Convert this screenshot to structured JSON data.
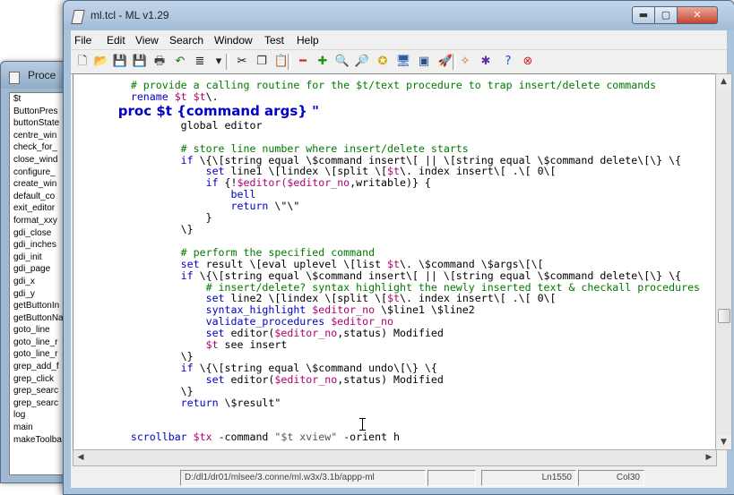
{
  "bg_window": {
    "title": "Proce",
    "items": [
      "$t",
      "ButtonPres",
      "buttonState",
      "centre_win",
      "check_for_",
      "close_wind",
      "configure_",
      "create_win",
      "default_co",
      "exit_editor",
      "format_xxy",
      "gdi_close",
      "gdi_inches",
      "gdi_init",
      "gdi_page",
      "gdi_x",
      "gdi_y",
      "getButtonIn",
      "getButtonNa",
      "goto_line",
      "goto_line_r",
      "goto_line_r",
      "grep_add_f",
      "grep_click",
      "grep_searc",
      "grep_searc",
      "log",
      "main",
      "makeToolba"
    ]
  },
  "window": {
    "title": "ml.tcl - ML v1.29",
    "min_label": "▬",
    "max_label": "▢",
    "close_label": "✕"
  },
  "menu": [
    "File",
    "Edit",
    "View",
    "Search",
    "Window",
    "Test",
    "Help"
  ],
  "toolbar": [
    {
      "icon": "new-file-icon",
      "glyph": "🗋",
      "color": "#3a3a3a"
    },
    {
      "icon": "open-folder-icon",
      "glyph": "📂",
      "color": "#c79a1b"
    },
    {
      "icon": "save-icon",
      "glyph": "💾",
      "color": "#333"
    },
    {
      "icon": "save-all-icon",
      "glyph": "💾",
      "color": "#333"
    },
    {
      "icon": "print-icon",
      "glyph": "🖶",
      "color": "#444"
    },
    {
      "icon": "undo-icon",
      "glyph": "↶",
      "color": "#1a7a1a"
    },
    {
      "icon": "format-icon",
      "glyph": "≣",
      "color": "#222"
    },
    {
      "icon": "dropdown-icon",
      "glyph": "▾",
      "color": "#222"
    },
    {
      "icon": "cut-icon",
      "glyph": "✂",
      "color": "#111"
    },
    {
      "icon": "copy-icon",
      "glyph": "❐",
      "color": "#333"
    },
    {
      "icon": "paste-icon",
      "glyph": "📋",
      "color": "#8a6a1e"
    },
    {
      "icon": "decrease-icon",
      "glyph": "━",
      "color": "#d12a1a"
    },
    {
      "icon": "increase-icon",
      "glyph": "✚",
      "color": "#1c9a1c"
    },
    {
      "icon": "find-icon",
      "glyph": "🔍",
      "color": "#222"
    },
    {
      "icon": "find-next-icon",
      "glyph": "🔎",
      "color": "#222"
    },
    {
      "icon": "bookmark-icon",
      "glyph": "✪",
      "color": "#d8a400"
    },
    {
      "icon": "monitor-icon",
      "glyph": "🖥",
      "color": "#2a5aa8"
    },
    {
      "icon": "window-icon",
      "glyph": "▣",
      "color": "#2a4f8a"
    },
    {
      "icon": "rocket-icon",
      "glyph": "🚀",
      "color": "#c2331e"
    },
    {
      "icon": "wand-icon",
      "glyph": "✧",
      "color": "#b47a00"
    },
    {
      "icon": "debug-icon",
      "glyph": "✱",
      "color": "#6a2aa0"
    },
    {
      "icon": "help-icon",
      "glyph": "?",
      "color": "#1a4fc0"
    },
    {
      "icon": "stop-icon",
      "glyph": "⊗",
      "color": "#d01e1e"
    }
  ],
  "code_lines": [
    [
      [
        "c",
        "        # provide a calling routine for the $t/text procedure to trap insert/delete commands"
      ]
    ],
    [
      [
        "k",
        "        rename "
      ],
      [
        "v",
        "$t $t"
      ],
      [
        "",
        "\\."
      ]
    ],
    [
      [
        "p",
        "        proc $t {command args} \""
      ]
    ],
    [
      [
        "",
        "                global editor"
      ]
    ],
    [
      [
        "",
        ""
      ]
    ],
    [
      [
        "c",
        "                # store line number where insert/delete starts"
      ]
    ],
    [
      [
        "k",
        "                if "
      ],
      [
        "",
        "\\{\\[string equal \\$command insert\\[ || \\[string equal \\$command delete\\[\\} \\{"
      ]
    ],
    [
      [
        "k",
        "                    set "
      ],
      [
        "",
        "line1 \\[lindex \\[split \\["
      ],
      [
        "v",
        "$t"
      ],
      [
        "",
        "\\. index insert\\[ .\\[ 0\\["
      ]
    ],
    [
      [
        "k",
        "                    if "
      ],
      [
        "",
        "{!"
      ],
      [
        "v",
        "$editor($editor_no"
      ],
      [
        "",
        ",writable)} {"
      ]
    ],
    [
      [
        "k",
        "                        bell"
      ]
    ],
    [
      [
        "k",
        "                        return "
      ],
      [
        "",
        "\\\"\\\""
      ]
    ],
    [
      [
        "",
        "                    }"
      ]
    ],
    [
      [
        "",
        "                \\}"
      ]
    ],
    [
      [
        "",
        ""
      ]
    ],
    [
      [
        "c",
        "                # perform the specified command"
      ]
    ],
    [
      [
        "k",
        "                set "
      ],
      [
        "",
        "result \\[eval uplevel \\[list "
      ],
      [
        "v",
        "$t"
      ],
      [
        "",
        "\\. \\$command \\$args\\[\\["
      ]
    ],
    [
      [
        "k",
        "                if "
      ],
      [
        "",
        "\\{\\[string equal \\$command insert\\[ || \\[string equal \\$command delete\\[\\} \\{"
      ]
    ],
    [
      [
        "c",
        "                    # insert/delete? syntax highlight the newly inserted text & checkall procedures"
      ]
    ],
    [
      [
        "k",
        "                    set "
      ],
      [
        "",
        "line2 \\[lindex \\[split \\["
      ],
      [
        "v",
        "$t"
      ],
      [
        "",
        "\\. index insert\\[ .\\[ 0\\["
      ]
    ],
    [
      [
        "k",
        "                    syntax_highlight "
      ],
      [
        "v",
        "$editor_no "
      ],
      [
        "",
        "\\$line1 \\$line2"
      ]
    ],
    [
      [
        "k",
        "                    validate_procedures "
      ],
      [
        "v",
        "$editor_no"
      ]
    ],
    [
      [
        "k",
        "                    set "
      ],
      [
        "",
        "editor("
      ],
      [
        "v",
        "$editor_no"
      ],
      [
        "",
        ",status) Modified"
      ]
    ],
    [
      [
        "v",
        "                    $t "
      ],
      [
        "",
        "see insert"
      ]
    ],
    [
      [
        "",
        "                \\}"
      ]
    ],
    [
      [
        "k",
        "                if "
      ],
      [
        "",
        "\\{\\[string equal \\$command undo\\[\\} \\{"
      ]
    ],
    [
      [
        "k",
        "                    set "
      ],
      [
        "",
        "editor("
      ],
      [
        "v",
        "$editor_no"
      ],
      [
        "",
        ",status) Modified"
      ]
    ],
    [
      [
        "",
        "                \\}"
      ]
    ],
    [
      [
        "k",
        "                return "
      ],
      [
        "",
        "\\$result\""
      ]
    ],
    [
      [
        "",
        ""
      ]
    ],
    [
      [
        "",
        ""
      ]
    ],
    [
      [
        "k",
        "        scrollbar "
      ],
      [
        "v",
        "$tx "
      ],
      [
        "",
        "-command "
      ],
      [
        "s",
        "\"$t xview\""
      ],
      [
        "",
        " -orient h"
      ]
    ]
  ],
  "status": {
    "path": "D:/dl1/dr01/mlsee/3.conne/ml.w3x/3.1b/appp-ml",
    "blank": "",
    "line": "Ln1550",
    "col": "Col30"
  }
}
